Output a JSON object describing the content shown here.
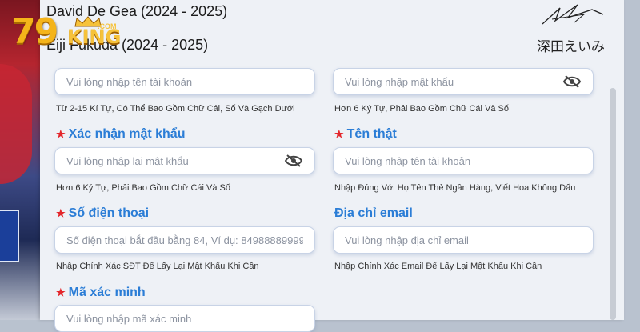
{
  "header": {
    "line1": "David De Gea (2024 - 2025)",
    "line2": "Eiji Fukuda (2024 - 2025)",
    "signature": "深田えいみ"
  },
  "logo": {
    "number": "79",
    "brand": "KING",
    "domain": ".COM"
  },
  "form": {
    "username": {
      "placeholder": "Vui lòng nhập tên tài khoản",
      "hint": "Từ 2-15 Kí Tự, Có Thể Bao Gồm Chữ Cái, Số Và Gạch Dưới"
    },
    "password": {
      "placeholder": "Vui lòng nhập mật khẩu",
      "hint": "Hơn 6 Ký Tự, Phải Bao Gồm Chữ Cái Và Số"
    },
    "confirm_password": {
      "label": "Xác nhận mật khẩu",
      "placeholder": "Vui lòng nhập lại mật khẩu",
      "hint": "Hơn 6 Ký Tự, Phải Bao Gồm Chữ Cái Và Số"
    },
    "real_name": {
      "label": "Tên thật",
      "placeholder": "Vui lòng nhập tên tài khoản",
      "hint": "Nhập Đúng Với Họ Tên Thẻ Ngân Hàng, Viết Hoa Không Dấu"
    },
    "phone": {
      "label": "Số điện thoại",
      "placeholder": "Số điện thoại bắt đầu bằng 84, Ví dụ: 84988889999",
      "hint": "Nhập Chính Xác SĐT Để Lấy Lại Mật Khẩu Khi Cần"
    },
    "email": {
      "label": "Địa chỉ email",
      "placeholder": "Vui lòng nhập địa chỉ email",
      "hint": "Nhập Chính Xác Email Để Lấy Lại Mật Khẩu Khi Cần"
    },
    "captcha": {
      "label": "Mã xác minh",
      "placeholder": "Vui lòng nhập mã xác minh"
    },
    "required_mark": "★"
  },
  "colors": {
    "label": "#2b7dd6",
    "required": "#e3262b",
    "logo": "#f4b41a"
  },
  "icons": {
    "password_toggle": "eye-slash-icon"
  }
}
